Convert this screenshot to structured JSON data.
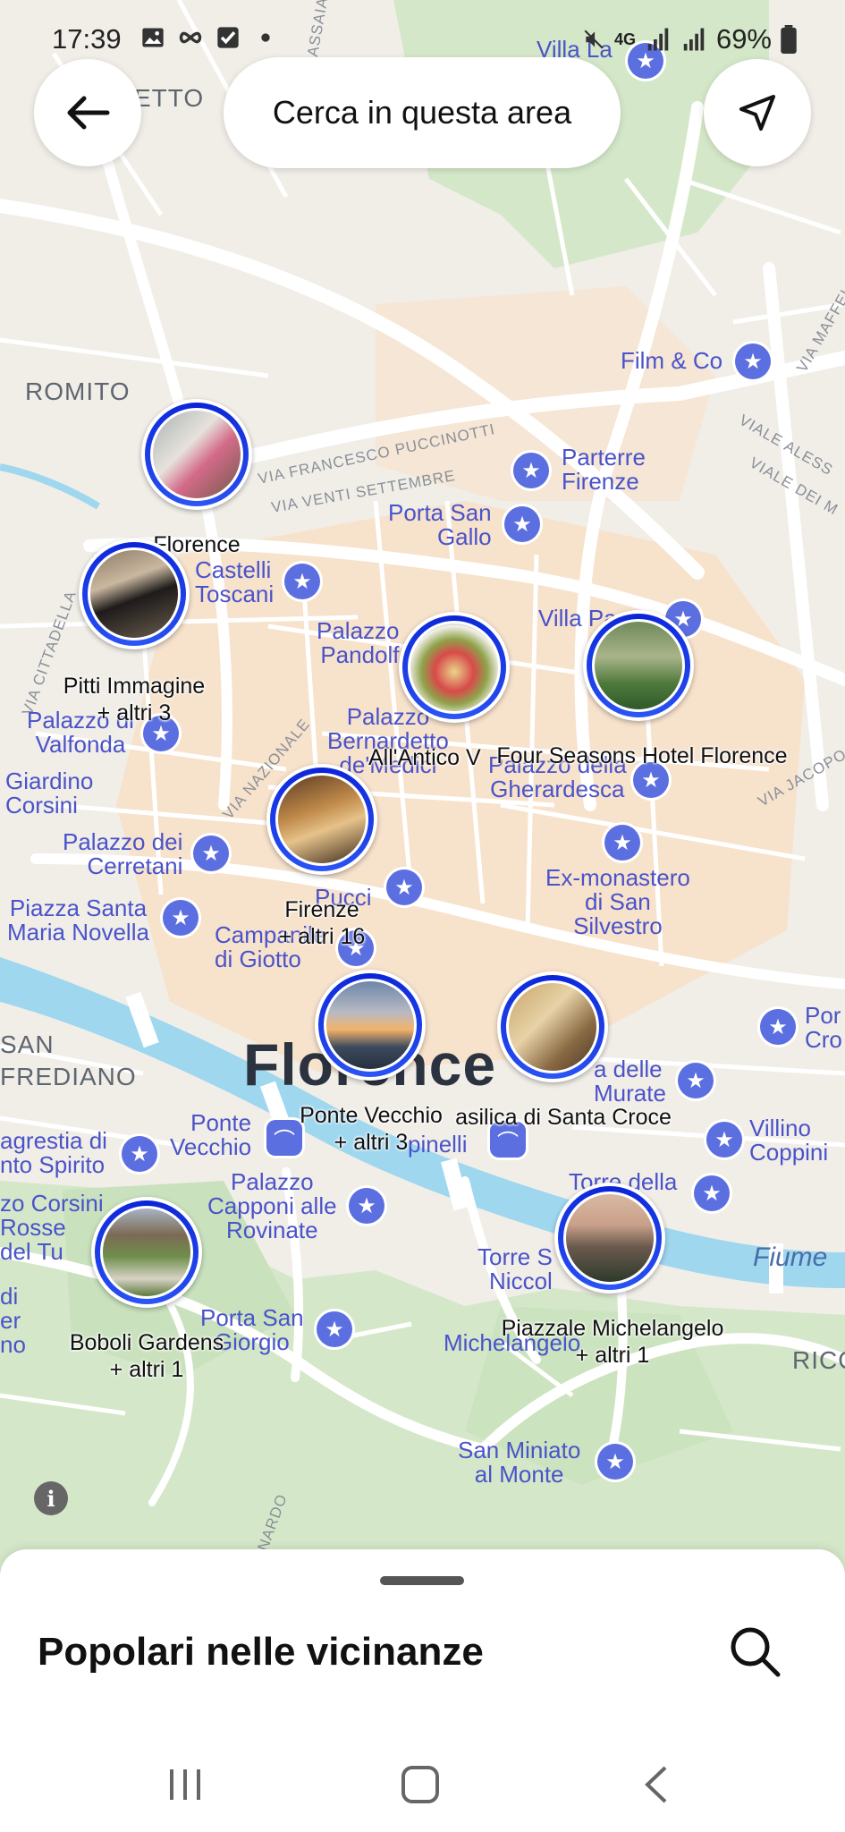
{
  "status_bar": {
    "time": "17:39",
    "network": "4G",
    "battery": "69%"
  },
  "top": {
    "search_area_label": "Cerca in questa area"
  },
  "map": {
    "areas": [
      "ROMITO",
      "SAN",
      "FREDIANO",
      "RICO",
      "ETTO"
    ],
    "streets": [
      "VIA FRANCESCO PUCCINOTTI",
      "VIA VENTI SETTEMBRE",
      "VIALE ALESS",
      "VIALE DEI M",
      "VIA MAFFEI",
      "VIA NAZIONALE",
      "VIA JACOPO",
      "VIA CITTADELLA",
      "ASSAIA",
      "NARDO"
    ],
    "pois": [
      "Film & Co",
      "Parterre\nFirenze",
      "Porta San\nGallo",
      "Castelli\nToscani",
      "Villa Pa",
      "Palazzo\nPandolf",
      "Palazzo di\nValfonda",
      "Palazzo\nBernardetto\nde'Medici",
      "Palazzo della\nGherardesca",
      "Giardino\nCorsini",
      "Palazzo dei\nCerretani",
      "Ex-monastero\ndi San\nSilvestro",
      "Piazza Santa\nMaria Novella",
      "Campanile\ndi Giotto",
      "Pucci",
      "Por\nCro",
      "a delle\nMurate",
      "Villino\nCoppini",
      "Ponte\nVecchio",
      "agrestia di\nnto Spirito",
      "pinelli",
      "Palazzo\nCapponi alle\nRovinate",
      "zo Corsini\nRosse\ndel Tu",
      "Torre della\nZecca",
      "Torre S\nNiccol",
      "Porta San\nGiorgio",
      "Michelangelo",
      "San Miniato\nal Monte",
      "Villa La",
      "di\ner\nno",
      "Fiume"
    ],
    "city_label": "Florence",
    "markers": [
      {
        "title": "Florence",
        "sub": ""
      },
      {
        "title": "Pitti Immagine",
        "sub": "+ altri 3"
      },
      {
        "title": "All'Antico V",
        "sub": ""
      },
      {
        "title": "Four Seasons Hotel Florence",
        "sub": ""
      },
      {
        "title": "Firenze",
        "sub": "+ altri 16"
      },
      {
        "title": "Ponte Vecchio",
        "sub": "+ altri 3"
      },
      {
        "title": "asilica di Santa Croce",
        "sub": ""
      },
      {
        "title": "Boboli Gardens",
        "sub": "+ altri 1"
      },
      {
        "title": "Piazzale Michelangelo",
        "sub": "+ altri 1"
      }
    ],
    "info_icon": "i"
  },
  "sheet": {
    "title": "Popolari nelle vicinanze"
  },
  "colors": {
    "ring_blue": "#0a24d8",
    "poi_blue": "#5b6fe0",
    "river": "#9fd7ef",
    "park": "#cfe6c4",
    "city_orange": "#f6dcc3"
  }
}
